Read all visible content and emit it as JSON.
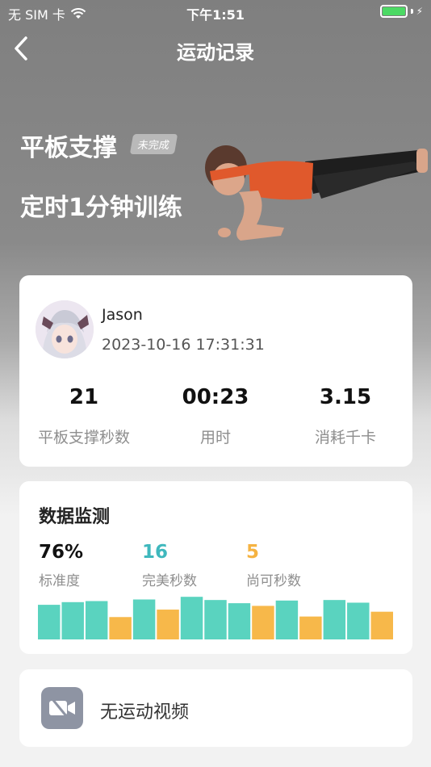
{
  "status_bar": {
    "carrier": "无 SIM 卡",
    "time": "下午1:51",
    "battery_level": 1.0
  },
  "nav": {
    "title": "运动记录",
    "back_icon": "chevron-left-icon"
  },
  "hero": {
    "exercise_name": "平板支撑",
    "status_badge": "未完成",
    "description": "定时1分钟训练"
  },
  "record": {
    "user_name": "Jason",
    "timestamp": "2023-10-16 17:31:31",
    "stats": [
      {
        "value": "21",
        "label": "平板支撑秒数"
      },
      {
        "value": "00:23",
        "label": "用时"
      },
      {
        "value": "3.15",
        "label": "消耗千卡"
      }
    ]
  },
  "monitor": {
    "title": "数据监测",
    "metrics": [
      {
        "value": "76%",
        "label": "标准度",
        "color": "#111111"
      },
      {
        "value": "16",
        "label": "完美秒数",
        "color": "#3fb8bd"
      },
      {
        "value": "5",
        "label": "尚可秒数",
        "color": "#f5b342"
      }
    ],
    "bar_colors": {
      "perfect": "#5ad3bf",
      "ok": "#f7b84a"
    },
    "bars": [
      {
        "level": 0.65,
        "kind": "perfect"
      },
      {
        "level": 0.7,
        "kind": "perfect"
      },
      {
        "level": 0.72,
        "kind": "perfect"
      },
      {
        "level": 0.42,
        "kind": "ok"
      },
      {
        "level": 0.75,
        "kind": "perfect"
      },
      {
        "level": 0.56,
        "kind": "ok"
      },
      {
        "level": 0.8,
        "kind": "perfect"
      },
      {
        "level": 0.74,
        "kind": "perfect"
      },
      {
        "level": 0.68,
        "kind": "perfect"
      },
      {
        "level": 0.63,
        "kind": "ok"
      },
      {
        "level": 0.73,
        "kind": "perfect"
      },
      {
        "level": 0.43,
        "kind": "ok"
      },
      {
        "level": 0.74,
        "kind": "perfect"
      },
      {
        "level": 0.69,
        "kind": "perfect"
      },
      {
        "level": 0.52,
        "kind": "ok"
      }
    ]
  },
  "video": {
    "label": "无运动视频",
    "icon": "video-off-icon"
  }
}
